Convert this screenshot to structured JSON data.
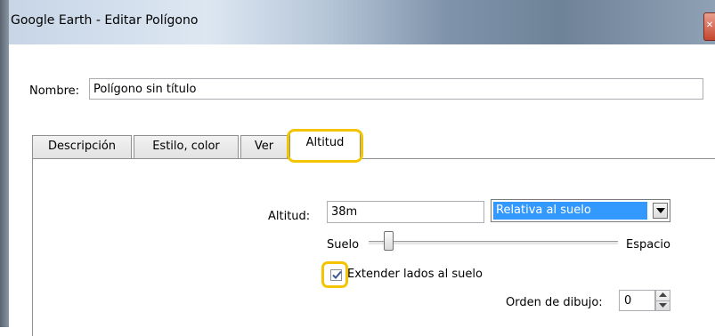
{
  "window": {
    "title": "Google Earth - Editar Polígono",
    "close_icon": "close-icon"
  },
  "name": {
    "label": "Nombre:",
    "value": "Polígono sin título"
  },
  "tabs": [
    {
      "label": "Descripción",
      "active": false
    },
    {
      "label": "Estilo, color",
      "active": false
    },
    {
      "label": "Ver",
      "active": false
    },
    {
      "label": "Altitud",
      "active": true
    }
  ],
  "altitude": {
    "label": "Altitud:",
    "value": "38m",
    "mode_selected": "Relativa al suelo",
    "slider_min_label": "Suelo",
    "slider_max_label": "Espacio",
    "extend_label": "Extender lados al suelo",
    "extend_checked": true,
    "draw_order_label": "Orden de dibujo:",
    "draw_order_value": "0"
  },
  "colors": {
    "highlight": "#f5c400",
    "selection": "#3399ff"
  }
}
